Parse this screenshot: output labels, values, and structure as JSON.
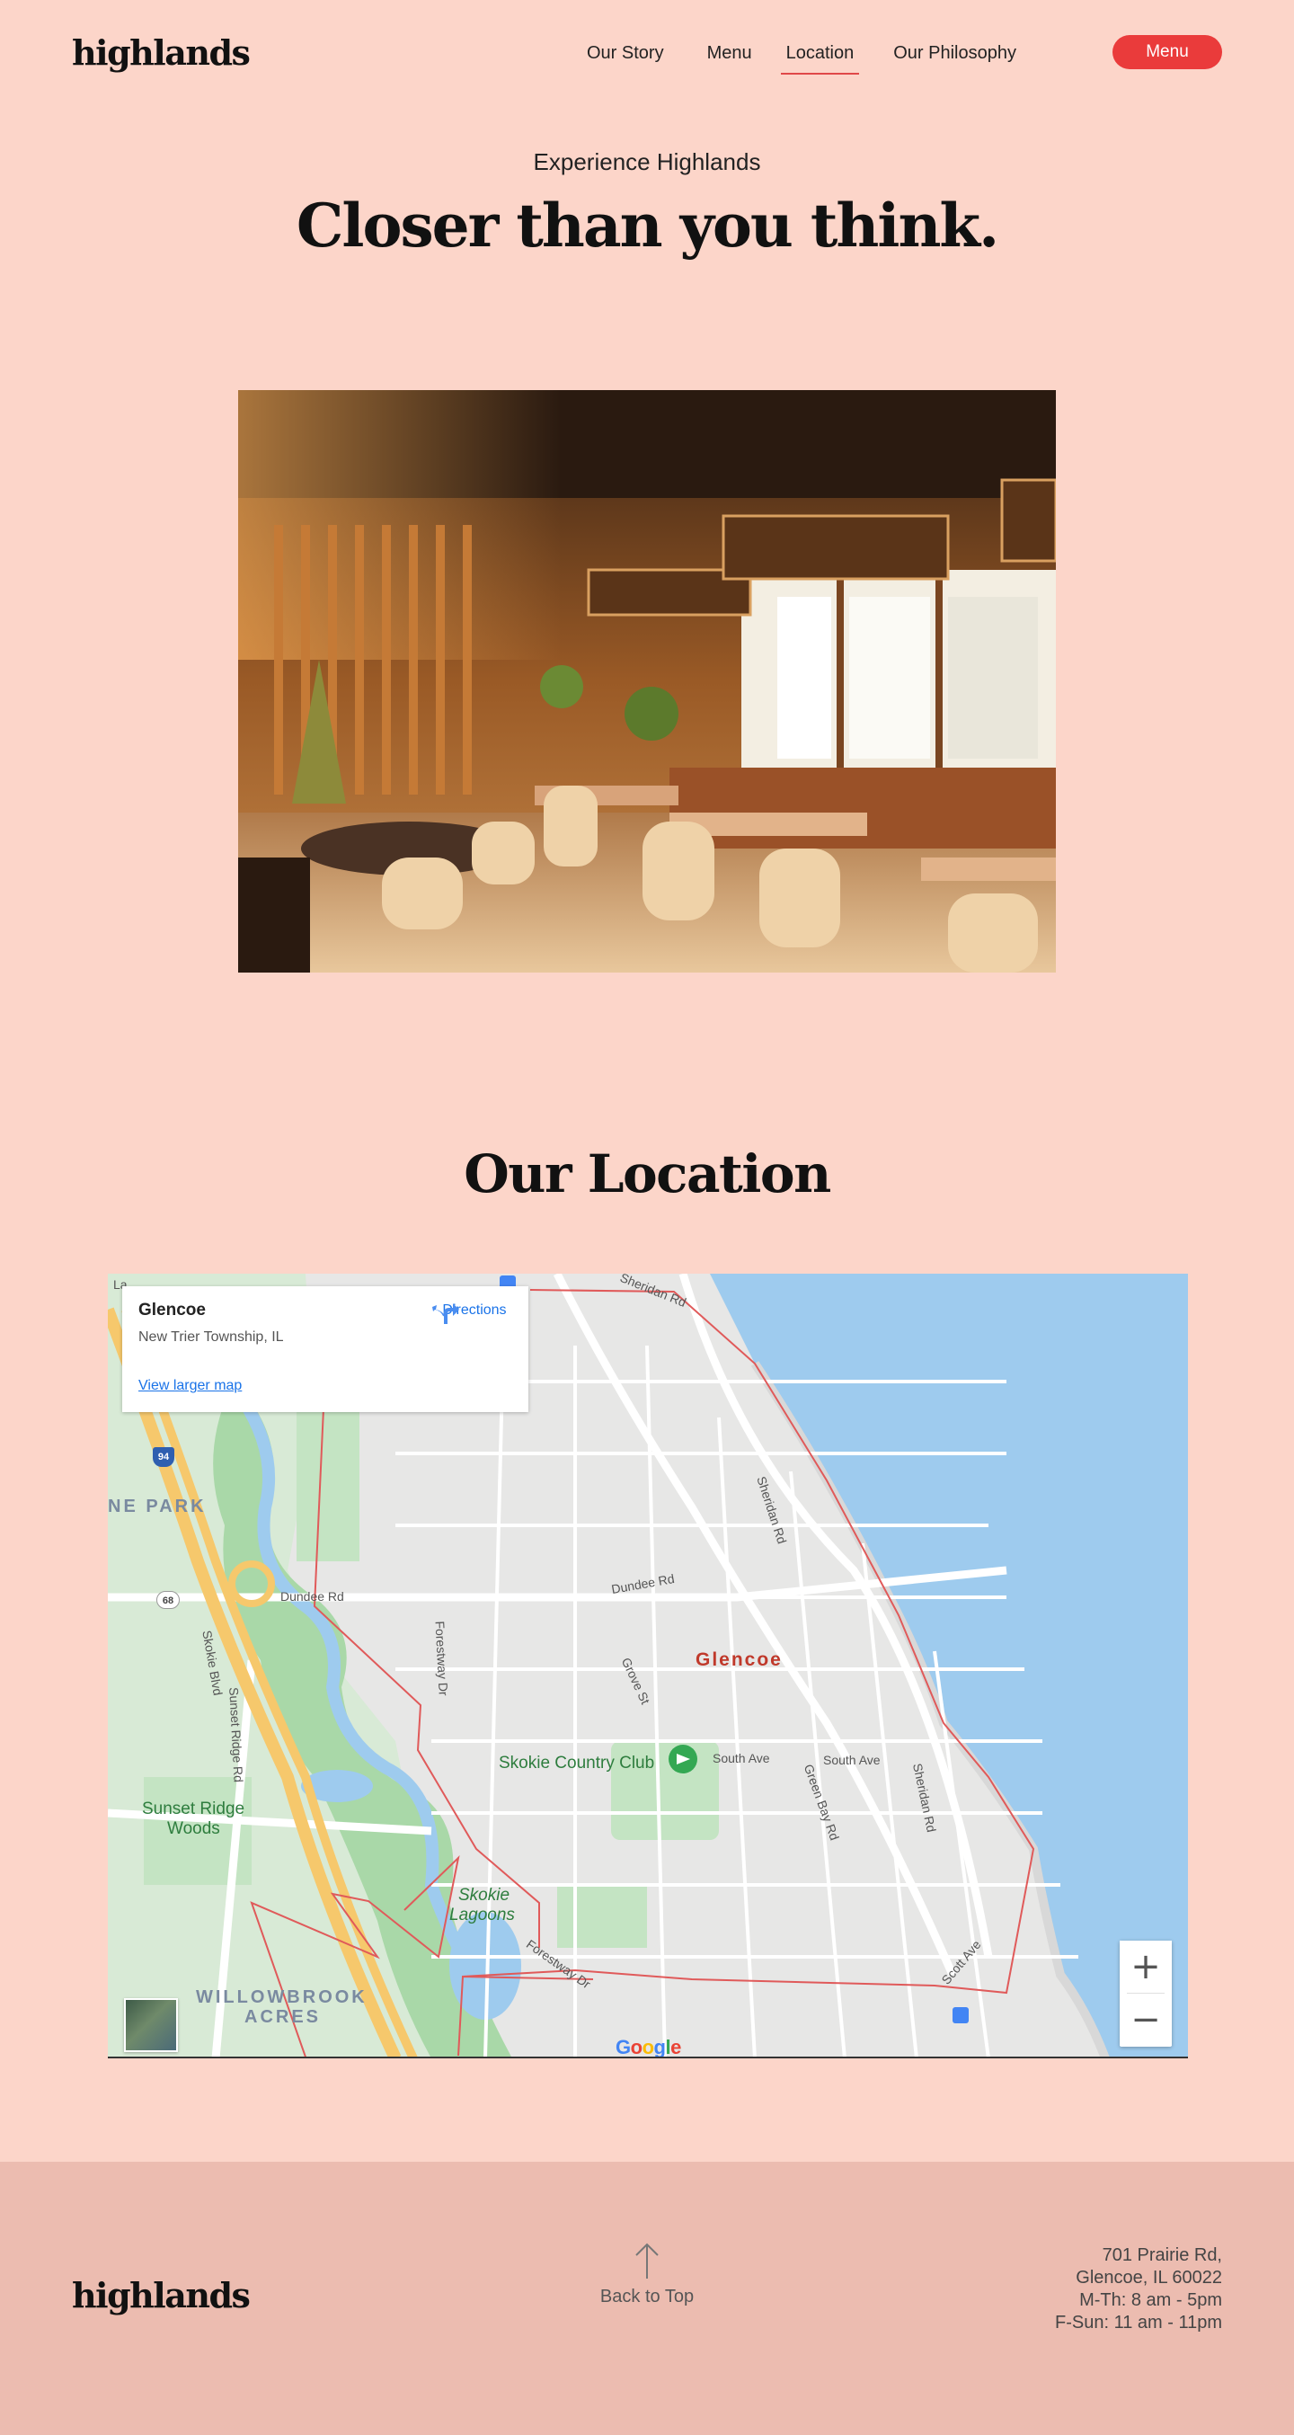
{
  "header": {
    "logo": "highlands",
    "nav": [
      {
        "label": "Our Story"
      },
      {
        "label": "Menu"
      },
      {
        "label": "Location",
        "active": true
      },
      {
        "label": "Our Philosophy"
      }
    ],
    "menu_button": "Menu"
  },
  "hero": {
    "eyebrow": "Experience Highlands",
    "title": "Closer than you think."
  },
  "location": {
    "title": "Our Location",
    "map": {
      "place_name": "Glencoe",
      "place_sub": "New Trier Township, IL",
      "directions_label": "Directions",
      "larger_map_label": "View larger map",
      "town_label": "Glencoe",
      "area_labels": [
        "NE PARK",
        "WILLOWBROOK",
        "ACRES"
      ],
      "park_labels": [
        "Skokie Country Club",
        "Sunset Ridge",
        "Woods",
        "Skokie",
        "Lagoons"
      ],
      "road_labels": [
        "Dundee Rd",
        "Dundee Rd",
        "Sheridan Rd",
        "Sheridan Rd",
        "Skokie Blvd",
        "Sunset Ridge Rd",
        "Forestway Dr",
        "Forestway Dr",
        "Grove St",
        "South Ave",
        "South Ave",
        "Green Bay Rd",
        "Scott Ave",
        "La",
        "Sheridan Rd"
      ],
      "shield_labels": [
        "94",
        "68"
      ],
      "google": "Google",
      "zoom_in": "+",
      "zoom_out": "−",
      "colors": {
        "water": "#9ecbee",
        "park": "#b9e2bc",
        "highway": "#f6c86c",
        "boundary": "#e05a5a"
      }
    }
  },
  "footer": {
    "logo": "highlands",
    "back_to_top": "Back to Top",
    "address_lines": [
      "701 Prairie Rd,",
      "Glencoe, IL 60022",
      "M-Th: 8 am - 5pm",
      "F-Sun: 11 am - 11pm"
    ]
  }
}
